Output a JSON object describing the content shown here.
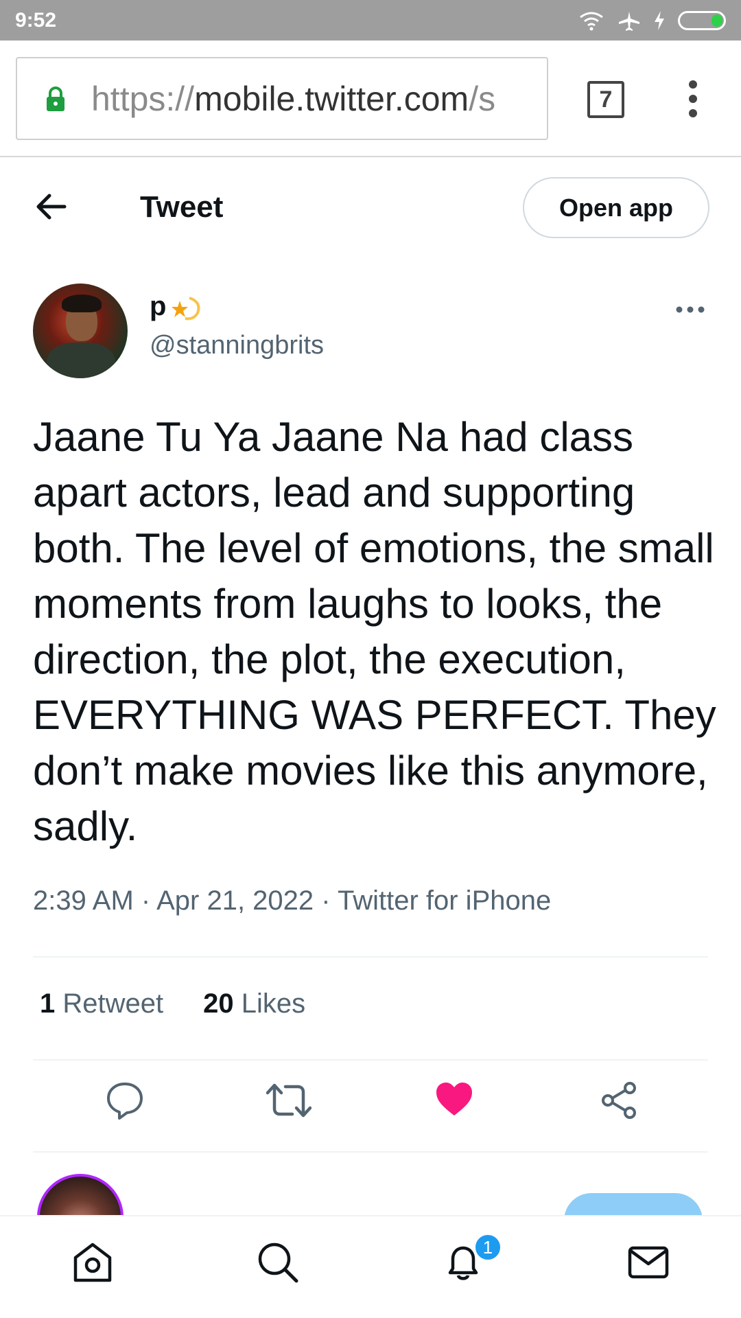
{
  "status_bar": {
    "time": "9:52"
  },
  "browser": {
    "url_scheme": "https://",
    "url_host": "mobile.twitter.com",
    "url_rest": "/s",
    "tab_count": "7"
  },
  "header": {
    "title": "Tweet",
    "open_app_label": "Open app"
  },
  "tweet": {
    "display_name": "p",
    "handle": "@stanningbrits",
    "text": "Jaane Tu Ya Jaane Na had class apart actors, lead and supporting both. The level of emotions, the small moments from laughs to looks, the direction, the plot, the execution, EVERYTHING WAS PERFECT. They don’t make movies like this anymore, sadly.",
    "timestamp": "2:39 AM · Apr 21, 2022 · Twitter for iPhone",
    "retweet_count": "1",
    "retweet_label": "Retweet",
    "like_count": "20",
    "like_label": "Likes",
    "liked": true,
    "like_color": "#f91880"
  },
  "bottom_nav": {
    "items": [
      "home-icon",
      "search-icon",
      "notifications-icon",
      "messages-icon"
    ],
    "notification_badge": "1",
    "accent_color": "#1d9bf0"
  }
}
